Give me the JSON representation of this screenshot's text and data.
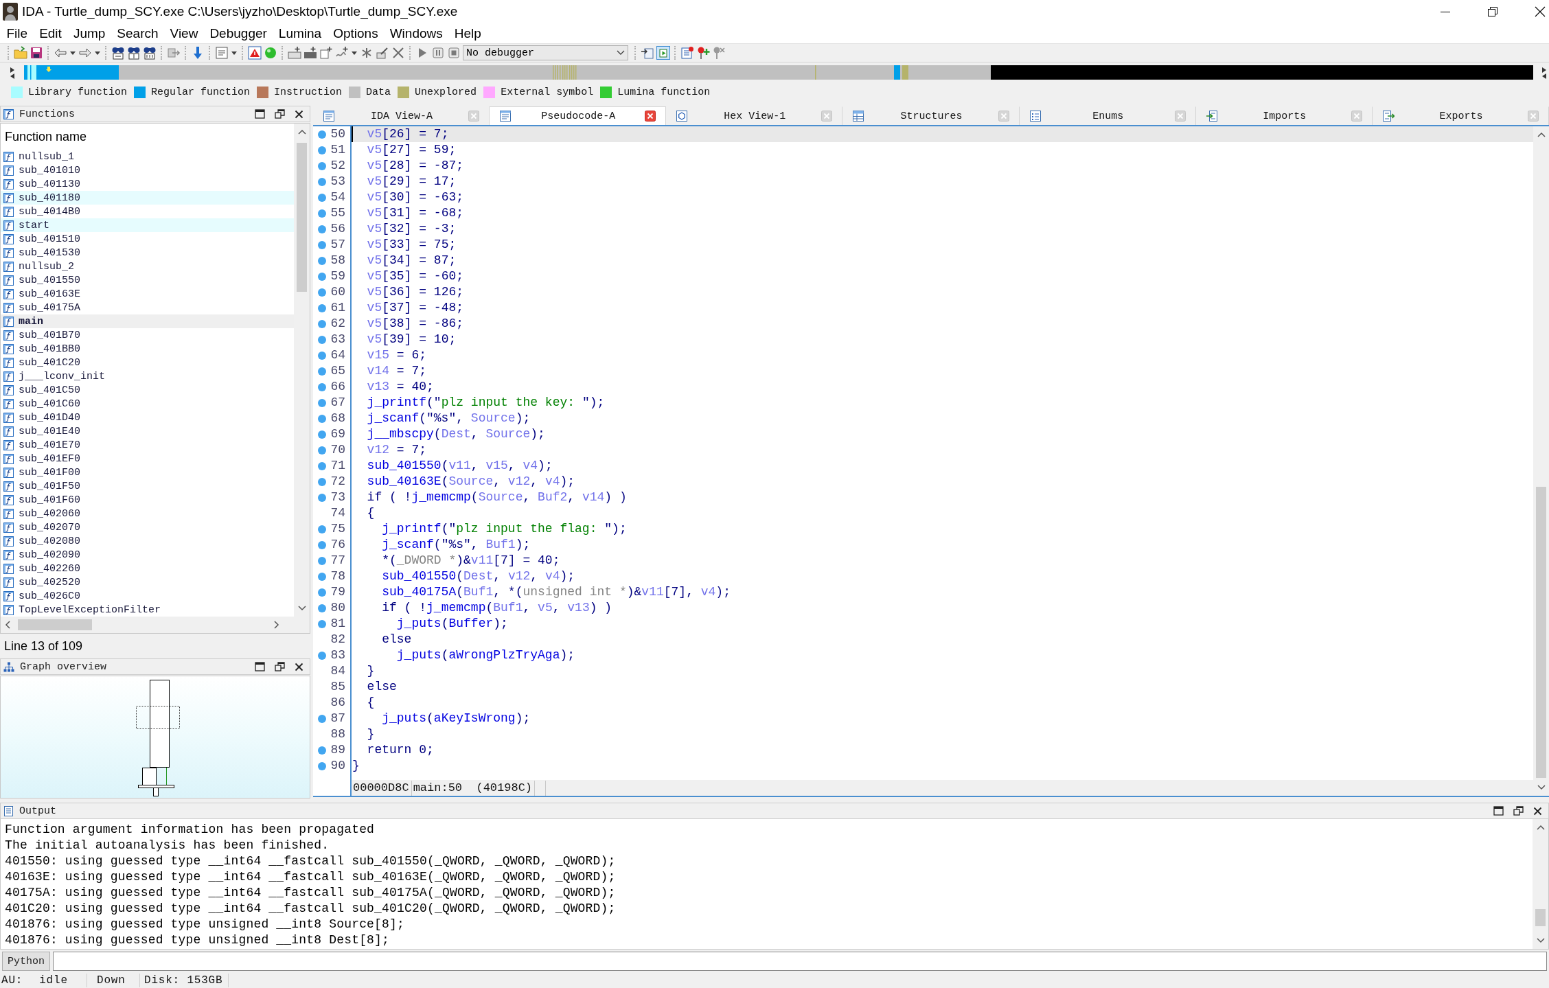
{
  "window": {
    "title": "IDA - Turtle_dump_SCY.exe C:\\Users\\jyzho\\Desktop\\Turtle_dump_SCY.exe"
  },
  "menu": [
    "File",
    "Edit",
    "Jump",
    "Search",
    "View",
    "Debugger",
    "Lumina",
    "Options",
    "Windows",
    "Help"
  ],
  "toolbar": {
    "debugger": "No debugger"
  },
  "legend": [
    {
      "label": "Library function",
      "color": "#a8fcff"
    },
    {
      "label": "Regular function",
      "color": "#00a0e8"
    },
    {
      "label": "Instruction",
      "color": "#b8785a"
    },
    {
      "label": "Data",
      "color": "#c0c0c0"
    },
    {
      "label": "Unexplored",
      "color": "#b5b36b"
    },
    {
      "label": "External symbol",
      "color": "#ffa8ff"
    },
    {
      "label": "Lumina function",
      "color": "#33cc33"
    }
  ],
  "functions_panel": {
    "title": "Functions",
    "column": "Function name",
    "items": [
      {
        "name": "nullsub_1",
        "highlighted": false,
        "selected": false
      },
      {
        "name": "sub_401010",
        "highlighted": false,
        "selected": false
      },
      {
        "name": "sub_401130",
        "highlighted": false,
        "selected": false
      },
      {
        "name": "sub_401180",
        "highlighted": true,
        "selected": false
      },
      {
        "name": "sub_4014B0",
        "highlighted": false,
        "selected": false
      },
      {
        "name": "start",
        "highlighted": true,
        "selected": false
      },
      {
        "name": "sub_401510",
        "highlighted": false,
        "selected": false
      },
      {
        "name": "sub_401530",
        "highlighted": false,
        "selected": false
      },
      {
        "name": "nullsub_2",
        "highlighted": false,
        "selected": false
      },
      {
        "name": "sub_401550",
        "highlighted": false,
        "selected": false
      },
      {
        "name": "sub_40163E",
        "highlighted": false,
        "selected": false
      },
      {
        "name": "sub_40175A",
        "highlighted": false,
        "selected": false
      },
      {
        "name": "main",
        "highlighted": false,
        "selected": true
      },
      {
        "name": "sub_401B70",
        "highlighted": false,
        "selected": false
      },
      {
        "name": "sub_401BB0",
        "highlighted": false,
        "selected": false
      },
      {
        "name": "sub_401C20",
        "highlighted": false,
        "selected": false
      },
      {
        "name": "j___lconv_init",
        "highlighted": false,
        "selected": false
      },
      {
        "name": "sub_401C50",
        "highlighted": false,
        "selected": false
      },
      {
        "name": "sub_401C60",
        "highlighted": false,
        "selected": false
      },
      {
        "name": "sub_401D40",
        "highlighted": false,
        "selected": false
      },
      {
        "name": "sub_401E40",
        "highlighted": false,
        "selected": false
      },
      {
        "name": "sub_401E70",
        "highlighted": false,
        "selected": false
      },
      {
        "name": "sub_401EF0",
        "highlighted": false,
        "selected": false
      },
      {
        "name": "sub_401F00",
        "highlighted": false,
        "selected": false
      },
      {
        "name": "sub_401F50",
        "highlighted": false,
        "selected": false
      },
      {
        "name": "sub_401F60",
        "highlighted": false,
        "selected": false
      },
      {
        "name": "sub_402060",
        "highlighted": false,
        "selected": false
      },
      {
        "name": "sub_402070",
        "highlighted": false,
        "selected": false
      },
      {
        "name": "sub_402080",
        "highlighted": false,
        "selected": false
      },
      {
        "name": "sub_402090",
        "highlighted": false,
        "selected": false
      },
      {
        "name": "sub_402260",
        "highlighted": false,
        "selected": false
      },
      {
        "name": "sub_402520",
        "highlighted": false,
        "selected": false
      },
      {
        "name": "sub_4026C0",
        "highlighted": false,
        "selected": false
      },
      {
        "name": "TopLevelExceptionFilter",
        "highlighted": false,
        "selected": false
      }
    ],
    "position": "Line 13 of 109"
  },
  "graph_overview": {
    "title": "Graph overview"
  },
  "tabs": [
    {
      "label": "IDA View-A",
      "kind": "disasm",
      "selected": false
    },
    {
      "label": "Pseudocode-A",
      "kind": "pseudocode",
      "selected": true
    },
    {
      "label": "Hex View-1",
      "kind": "hex",
      "selected": false
    },
    {
      "label": "Structures",
      "kind": "structures",
      "selected": false
    },
    {
      "label": "Enums",
      "kind": "enums",
      "selected": false
    },
    {
      "label": "Imports",
      "kind": "imports",
      "selected": false
    },
    {
      "label": "Exports",
      "kind": "exports",
      "selected": false
    }
  ],
  "pseudocode": {
    "lines": [
      {
        "number": "50",
        "dot": true,
        "selected": true,
        "parts": [
          {
            "kind": "var",
            "text": "  v5"
          },
          {
            "kind": "plain",
            "text": "[26] = 7;"
          }
        ]
      },
      {
        "number": "51",
        "dot": true,
        "selected": false,
        "parts": [
          {
            "kind": "var",
            "text": "  v5"
          },
          {
            "kind": "plain",
            "text": "[27] = 59;"
          }
        ]
      },
      {
        "number": "52",
        "dot": true,
        "selected": false,
        "parts": [
          {
            "kind": "var",
            "text": "  v5"
          },
          {
            "kind": "plain",
            "text": "[28] = -87;"
          }
        ]
      },
      {
        "number": "53",
        "dot": true,
        "selected": false,
        "parts": [
          {
            "kind": "var",
            "text": "  v5"
          },
          {
            "kind": "plain",
            "text": "[29] = 17;"
          }
        ]
      },
      {
        "number": "54",
        "dot": true,
        "selected": false,
        "parts": [
          {
            "kind": "var",
            "text": "  v5"
          },
          {
            "kind": "plain",
            "text": "[30] = -63;"
          }
        ]
      },
      {
        "number": "55",
        "dot": true,
        "selected": false,
        "parts": [
          {
            "kind": "var",
            "text": "  v5"
          },
          {
            "kind": "plain",
            "text": "[31] = -68;"
          }
        ]
      },
      {
        "number": "56",
        "dot": true,
        "selected": false,
        "parts": [
          {
            "kind": "var",
            "text": "  v5"
          },
          {
            "kind": "plain",
            "text": "[32] = -3;"
          }
        ]
      },
      {
        "number": "57",
        "dot": true,
        "selected": false,
        "parts": [
          {
            "kind": "var",
            "text": "  v5"
          },
          {
            "kind": "plain",
            "text": "[33] = 75;"
          }
        ]
      },
      {
        "number": "58",
        "dot": true,
        "selected": false,
        "parts": [
          {
            "kind": "var",
            "text": "  v5"
          },
          {
            "kind": "plain",
            "text": "[34] = 87;"
          }
        ]
      },
      {
        "number": "59",
        "dot": true,
        "selected": false,
        "parts": [
          {
            "kind": "var",
            "text": "  v5"
          },
          {
            "kind": "plain",
            "text": "[35] = -60;"
          }
        ]
      },
      {
        "number": "60",
        "dot": true,
        "selected": false,
        "parts": [
          {
            "kind": "var",
            "text": "  v5"
          },
          {
            "kind": "plain",
            "text": "[36] = 126;"
          }
        ]
      },
      {
        "number": "61",
        "dot": true,
        "selected": false,
        "parts": [
          {
            "kind": "var",
            "text": "  v5"
          },
          {
            "kind": "plain",
            "text": "[37] = -48;"
          }
        ]
      },
      {
        "number": "62",
        "dot": true,
        "selected": false,
        "parts": [
          {
            "kind": "var",
            "text": "  v5"
          },
          {
            "kind": "plain",
            "text": "[38] = -86;"
          }
        ]
      },
      {
        "number": "63",
        "dot": true,
        "selected": false,
        "parts": [
          {
            "kind": "var",
            "text": "  v5"
          },
          {
            "kind": "plain",
            "text": "[39] = 10;"
          }
        ]
      },
      {
        "number": "64",
        "dot": true,
        "selected": false,
        "parts": [
          {
            "kind": "var",
            "text": "  v15"
          },
          {
            "kind": "plain",
            "text": " = 6;"
          }
        ]
      },
      {
        "number": "65",
        "dot": true,
        "selected": false,
        "parts": [
          {
            "kind": "var",
            "text": "  v14"
          },
          {
            "kind": "plain",
            "text": " = 7;"
          }
        ]
      },
      {
        "number": "66",
        "dot": true,
        "selected": false,
        "parts": [
          {
            "kind": "var",
            "text": "  v13"
          },
          {
            "kind": "plain",
            "text": " = 40;"
          }
        ]
      },
      {
        "number": "67",
        "dot": true,
        "selected": false,
        "parts": [
          {
            "kind": "name",
            "text": "  j_printf"
          },
          {
            "kind": "plain",
            "text": "(\""
          },
          {
            "kind": "str",
            "text": "plz input the key: "
          },
          {
            "kind": "plain",
            "text": "\");"
          }
        ]
      },
      {
        "number": "68",
        "dot": true,
        "selected": false,
        "parts": [
          {
            "kind": "name",
            "text": "  j_scanf"
          },
          {
            "kind": "plain",
            "text": "(\"%s\", "
          },
          {
            "kind": "var",
            "text": "Source"
          },
          {
            "kind": "plain",
            "text": ");"
          }
        ]
      },
      {
        "number": "69",
        "dot": true,
        "selected": false,
        "parts": [
          {
            "kind": "name",
            "text": "  j__mbscpy"
          },
          {
            "kind": "plain",
            "text": "("
          },
          {
            "kind": "var",
            "text": "Dest"
          },
          {
            "kind": "plain",
            "text": ", "
          },
          {
            "kind": "var",
            "text": "Source"
          },
          {
            "kind": "plain",
            "text": ");"
          }
        ]
      },
      {
        "number": "70",
        "dot": true,
        "selected": false,
        "parts": [
          {
            "kind": "var",
            "text": "  v12"
          },
          {
            "kind": "plain",
            "text": " = 7;"
          }
        ]
      },
      {
        "number": "71",
        "dot": true,
        "selected": false,
        "parts": [
          {
            "kind": "name",
            "text": "  sub_401550"
          },
          {
            "kind": "plain",
            "text": "("
          },
          {
            "kind": "var",
            "text": "v11"
          },
          {
            "kind": "plain",
            "text": ", "
          },
          {
            "kind": "var",
            "text": "v15"
          },
          {
            "kind": "plain",
            "text": ", "
          },
          {
            "kind": "var",
            "text": "v4"
          },
          {
            "kind": "plain",
            "text": ");"
          }
        ]
      },
      {
        "number": "72",
        "dot": true,
        "selected": false,
        "parts": [
          {
            "kind": "name",
            "text": "  sub_40163E"
          },
          {
            "kind": "plain",
            "text": "("
          },
          {
            "kind": "var",
            "text": "Source"
          },
          {
            "kind": "plain",
            "text": ", "
          },
          {
            "kind": "var",
            "text": "v12"
          },
          {
            "kind": "plain",
            "text": ", "
          },
          {
            "kind": "var",
            "text": "v4"
          },
          {
            "kind": "plain",
            "text": ");"
          }
        ]
      },
      {
        "number": "73",
        "dot": true,
        "selected": false,
        "parts": [
          {
            "kind": "plain",
            "text": "  if ( !"
          },
          {
            "kind": "name",
            "text": "j_memcmp"
          },
          {
            "kind": "plain",
            "text": "("
          },
          {
            "kind": "var",
            "text": "Source"
          },
          {
            "kind": "plain",
            "text": ", "
          },
          {
            "kind": "var",
            "text": "Buf2"
          },
          {
            "kind": "plain",
            "text": ", "
          },
          {
            "kind": "var",
            "text": "v14"
          },
          {
            "kind": "plain",
            "text": ") )"
          }
        ]
      },
      {
        "number": "74",
        "dot": false,
        "selected": false,
        "parts": [
          {
            "kind": "plain",
            "text": "  {"
          }
        ]
      },
      {
        "number": "75",
        "dot": true,
        "selected": false,
        "parts": [
          {
            "kind": "name",
            "text": "    j_printf"
          },
          {
            "kind": "plain",
            "text": "(\""
          },
          {
            "kind": "str",
            "text": "plz input the flag: "
          },
          {
            "kind": "plain",
            "text": "\");"
          }
        ]
      },
      {
        "number": "76",
        "dot": true,
        "selected": false,
        "parts": [
          {
            "kind": "name",
            "text": "    j_scanf"
          },
          {
            "kind": "plain",
            "text": "(\"%s\", "
          },
          {
            "kind": "var",
            "text": "Buf1"
          },
          {
            "kind": "plain",
            "text": ");"
          }
        ]
      },
      {
        "number": "77",
        "dot": true,
        "selected": false,
        "parts": [
          {
            "kind": "plain",
            "text": "    *("
          },
          {
            "kind": "type",
            "text": "_DWORD *"
          },
          {
            "kind": "plain",
            "text": ")&"
          },
          {
            "kind": "var",
            "text": "v11"
          },
          {
            "kind": "plain",
            "text": "[7] = 40;"
          }
        ]
      },
      {
        "number": "78",
        "dot": true,
        "selected": false,
        "parts": [
          {
            "kind": "name",
            "text": "    sub_401550"
          },
          {
            "kind": "plain",
            "text": "("
          },
          {
            "kind": "var",
            "text": "Dest"
          },
          {
            "kind": "plain",
            "text": ", "
          },
          {
            "kind": "var",
            "text": "v12"
          },
          {
            "kind": "plain",
            "text": ", "
          },
          {
            "kind": "var",
            "text": "v4"
          },
          {
            "kind": "plain",
            "text": ");"
          }
        ]
      },
      {
        "number": "79",
        "dot": true,
        "selected": false,
        "parts": [
          {
            "kind": "name",
            "text": "    sub_40175A"
          },
          {
            "kind": "plain",
            "text": "("
          },
          {
            "kind": "var",
            "text": "Buf1"
          },
          {
            "kind": "plain",
            "text": ", *("
          },
          {
            "kind": "type",
            "text": "unsigned int *"
          },
          {
            "kind": "plain",
            "text": ")&"
          },
          {
            "kind": "var",
            "text": "v11"
          },
          {
            "kind": "plain",
            "text": "[7], "
          },
          {
            "kind": "var",
            "text": "v4"
          },
          {
            "kind": "plain",
            "text": ");"
          }
        ]
      },
      {
        "number": "80",
        "dot": true,
        "selected": false,
        "parts": [
          {
            "kind": "plain",
            "text": "    if ( !"
          },
          {
            "kind": "name",
            "text": "j_memcmp"
          },
          {
            "kind": "plain",
            "text": "("
          },
          {
            "kind": "var",
            "text": "Buf1"
          },
          {
            "kind": "plain",
            "text": ", "
          },
          {
            "kind": "var",
            "text": "v5"
          },
          {
            "kind": "plain",
            "text": ", "
          },
          {
            "kind": "var",
            "text": "v13"
          },
          {
            "kind": "plain",
            "text": ") )"
          }
        ]
      },
      {
        "number": "81",
        "dot": true,
        "selected": false,
        "parts": [
          {
            "kind": "name",
            "text": "      j_puts"
          },
          {
            "kind": "plain",
            "text": "("
          },
          {
            "kind": "name",
            "text": "Buffer"
          },
          {
            "kind": "plain",
            "text": ");"
          }
        ]
      },
      {
        "number": "82",
        "dot": false,
        "selected": false,
        "parts": [
          {
            "kind": "plain",
            "text": "    else"
          }
        ]
      },
      {
        "number": "83",
        "dot": true,
        "selected": false,
        "parts": [
          {
            "kind": "name",
            "text": "      j_puts"
          },
          {
            "kind": "plain",
            "text": "("
          },
          {
            "kind": "name",
            "text": "aWrongPlzTryAga"
          },
          {
            "kind": "plain",
            "text": ");"
          }
        ]
      },
      {
        "number": "84",
        "dot": false,
        "selected": false,
        "parts": [
          {
            "kind": "plain",
            "text": "  }"
          }
        ]
      },
      {
        "number": "85",
        "dot": false,
        "selected": false,
        "parts": [
          {
            "kind": "plain",
            "text": "  else"
          }
        ]
      },
      {
        "number": "86",
        "dot": false,
        "selected": false,
        "parts": [
          {
            "kind": "plain",
            "text": "  {"
          }
        ]
      },
      {
        "number": "87",
        "dot": true,
        "selected": false,
        "parts": [
          {
            "kind": "name",
            "text": "    j_puts"
          },
          {
            "kind": "plain",
            "text": "("
          },
          {
            "kind": "name",
            "text": "aKeyIsWrong"
          },
          {
            "kind": "plain",
            "text": ");"
          }
        ]
      },
      {
        "number": "88",
        "dot": false,
        "selected": false,
        "parts": [
          {
            "kind": "plain",
            "text": "  }"
          }
        ]
      },
      {
        "number": "89",
        "dot": true,
        "selected": false,
        "parts": [
          {
            "kind": "plain",
            "text": "  return 0;"
          }
        ]
      },
      {
        "number": "90",
        "dot": true,
        "selected": false,
        "parts": [
          {
            "kind": "plain",
            "text": "}"
          }
        ]
      }
    ],
    "status": {
      "offset": "00000D8C",
      "location": "main:50  (40198C)"
    }
  },
  "output": {
    "title": "Output",
    "lines": [
      "Function argument information has been propagated",
      "The initial autoanalysis has been finished.",
      "401550: using guessed type __int64 __fastcall sub_401550(_QWORD, _QWORD, _QWORD);",
      "40163E: using guessed type __int64 __fastcall sub_40163E(_QWORD, _QWORD, _QWORD);",
      "40175A: using guessed type __int64 __fastcall sub_40175A(_QWORD, _QWORD, _QWORD);",
      "401C20: using guessed type __int64 __fastcall sub_401C20(_QWORD, _QWORD, _QWORD);",
      "401876: using guessed type unsigned __int8 Source[8];",
      "401876: using guessed type unsigned __int8 Dest[8];"
    ]
  },
  "command_line": {
    "language": "Python"
  },
  "status_bar": {
    "au_label": "AU:",
    "au_state": "idle",
    "direction": "Down",
    "disk": "Disk: 153GB"
  }
}
